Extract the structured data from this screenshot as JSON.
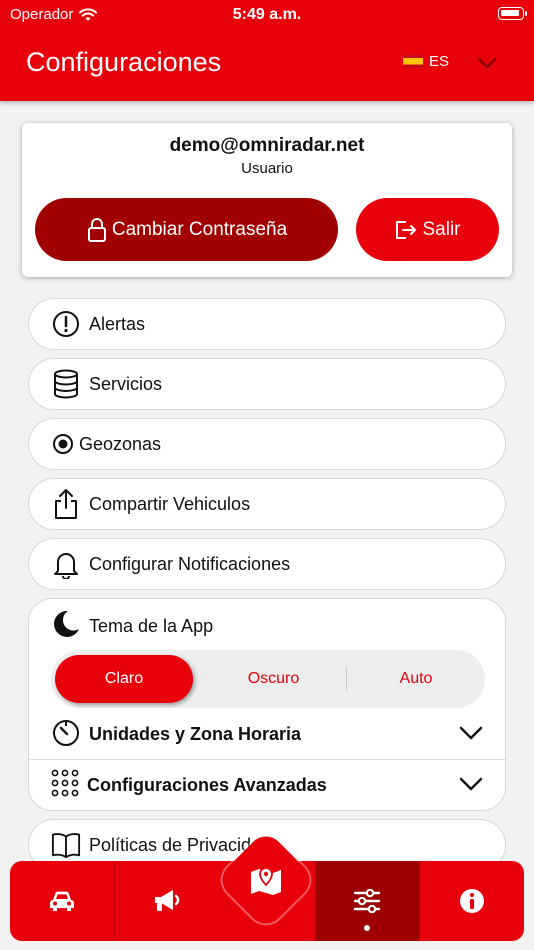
{
  "status_bar": {
    "carrier": "Operador",
    "time": "5:49 a.m."
  },
  "header": {
    "title": "Configuraciones",
    "language": "ES"
  },
  "user": {
    "email": "demo@omniradar.net",
    "role": "Usuario",
    "change_password_label": "Cambiar Contraseña",
    "logout_label": "Salir"
  },
  "menu": [
    {
      "label": "Alertas",
      "icon": "alert-circle-icon"
    },
    {
      "label": "Servicios",
      "icon": "database-icon"
    },
    {
      "label": "Geozonas",
      "icon": "radio-target-icon"
    },
    {
      "label": "Compartir Vehiculos",
      "icon": "share-icon"
    },
    {
      "label": "Configurar Notificaciones",
      "icon": "bell-icon"
    }
  ],
  "theme": {
    "title": "Tema de la App",
    "options": [
      "Claro",
      "Oscuro",
      "Auto"
    ],
    "selected": "Claro"
  },
  "units": {
    "label": "Unidades y Zona Horaria"
  },
  "advanced": {
    "label": "Configuraciones Avanzadas"
  },
  "privacy": {
    "label": "Políticas de Privacidad"
  },
  "colors": {
    "primary": "#e8000b",
    "dark": "#a00000"
  }
}
